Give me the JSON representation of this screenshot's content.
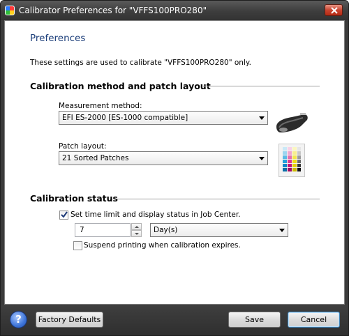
{
  "window": {
    "title": "Calibrator Preferences for \"VFFS100PRO280\""
  },
  "preferences": {
    "heading": "Preferences",
    "description": "These settings are used to calibrate \"VFFS100PRO280\" only."
  },
  "calibration_method": {
    "section_title": "Calibration method and patch layout",
    "measurement_label": "Measurement method:",
    "measurement_value": "EFI ES-2000 [ES-1000 compatible]",
    "patch_label": "Patch layout:",
    "patch_value": "21 Sorted Patches"
  },
  "calibration_status": {
    "section_title": "Calibration status",
    "time_limit_label": "Set time limit and display status in Job Center.",
    "time_limit_checked": true,
    "time_value": "7",
    "unit_value": "Day(s)",
    "suspend_label": "Suspend printing when calibration expires.",
    "suspend_checked": false
  },
  "footer": {
    "factory_defaults": "Factory Defaults",
    "save": "Save",
    "cancel": "Cancel"
  }
}
